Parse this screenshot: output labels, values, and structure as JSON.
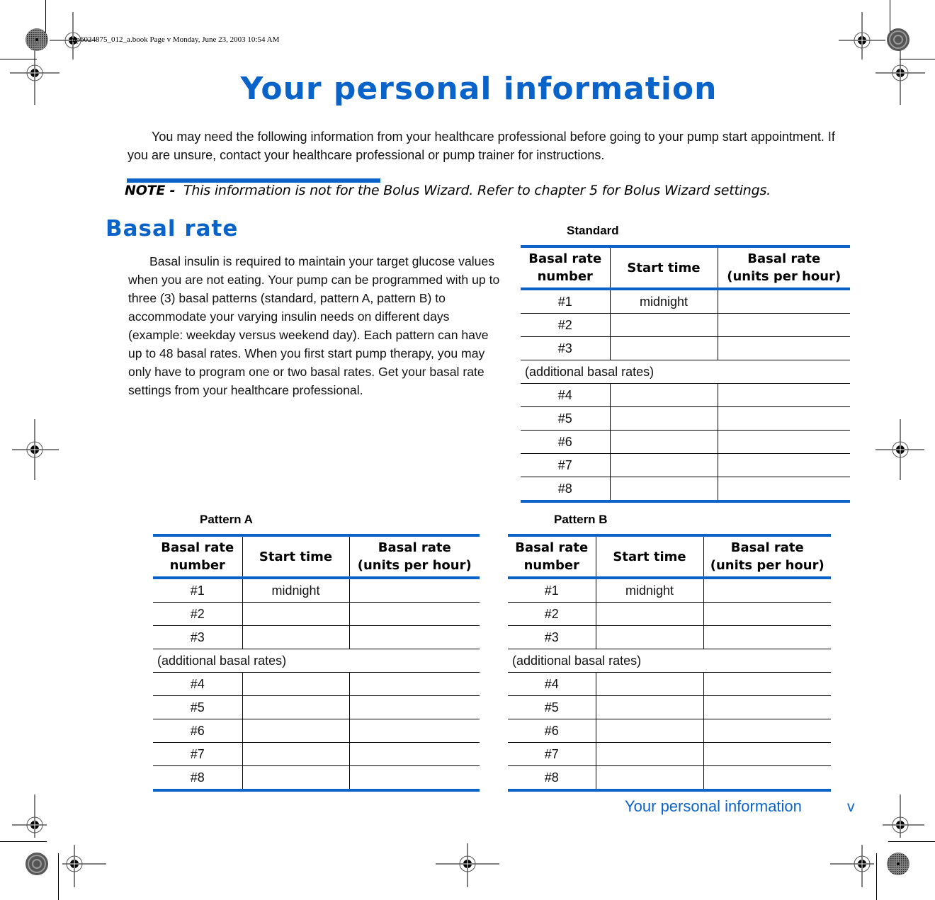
{
  "slug": "mp6024875_012_a.book  Page v  Monday, June 23, 2003  10:54 AM",
  "title": "Your personal information",
  "intro": "You may need the following information from your healthcare professional before going to your pump start appointment. If you are unsure, contact your healthcare professional or pump trainer for instructions.",
  "note": {
    "label": "NOTE -",
    "text": "This information is not for the Bolus Wizard. Refer to chapter 5 for Bolus Wizard settings."
  },
  "section": {
    "heading": "Basal rate",
    "paragraph": "Basal insulin is required to maintain your target glucose values when you are not eating. Your pump can be programmed with up to three (3) basal patterns (standard, pattern A, pattern B) to accommodate your varying insulin needs on different days (example: weekday versus weekend day). Each pattern can have up to 48 basal rates. When you first start pump therapy, you may only have to program one or two basal rates. Get your basal rate settings from your healthcare professional."
  },
  "table_headers": {
    "number_line1": "Basal rate",
    "number_line2": "number",
    "start_time": "Start time",
    "rate_line1": "Basal rate",
    "rate_line2": "(units per hour)"
  },
  "tables": [
    {
      "label": "Standard",
      "rows": [
        {
          "number": "#1",
          "start": "midnight",
          "rate": ""
        },
        {
          "number": "#2",
          "start": "",
          "rate": ""
        },
        {
          "number": "#3",
          "start": "",
          "rate": ""
        }
      ],
      "additional_label": "(additional basal rates)",
      "additional_rows": [
        {
          "number": "#4",
          "start": "",
          "rate": ""
        },
        {
          "number": "#5",
          "start": "",
          "rate": ""
        },
        {
          "number": "#6",
          "start": "",
          "rate": ""
        },
        {
          "number": "#7",
          "start": "",
          "rate": ""
        },
        {
          "number": "#8",
          "start": "",
          "rate": ""
        }
      ]
    },
    {
      "label": "Pattern A",
      "rows": [
        {
          "number": "#1",
          "start": "midnight",
          "rate": ""
        },
        {
          "number": "#2",
          "start": "",
          "rate": ""
        },
        {
          "number": "#3",
          "start": "",
          "rate": ""
        }
      ],
      "additional_label": "(additional basal rates)",
      "additional_rows": [
        {
          "number": "#4",
          "start": "",
          "rate": ""
        },
        {
          "number": "#5",
          "start": "",
          "rate": ""
        },
        {
          "number": "#6",
          "start": "",
          "rate": ""
        },
        {
          "number": "#7",
          "start": "",
          "rate": ""
        },
        {
          "number": "#8",
          "start": "",
          "rate": ""
        }
      ]
    },
    {
      "label": "Pattern B",
      "rows": [
        {
          "number": "#1",
          "start": "midnight",
          "rate": ""
        },
        {
          "number": "#2",
          "start": "",
          "rate": ""
        },
        {
          "number": "#3",
          "start": "",
          "rate": ""
        }
      ],
      "additional_label": "(additional basal rates)",
      "additional_rows": [
        {
          "number": "#4",
          "start": "",
          "rate": ""
        },
        {
          "number": "#5",
          "start": "",
          "rate": ""
        },
        {
          "number": "#6",
          "start": "",
          "rate": ""
        },
        {
          "number": "#7",
          "start": "",
          "rate": ""
        },
        {
          "number": "#8",
          "start": "",
          "rate": ""
        }
      ]
    }
  ],
  "footer": {
    "running_title": "Your personal information",
    "page_number": "v"
  },
  "colors": {
    "accent": "#0a63c9",
    "text": "#000000"
  },
  "icons": {
    "registration_mark": "crosshair-registration-icon",
    "color_bar_star": "star-target-icon"
  }
}
